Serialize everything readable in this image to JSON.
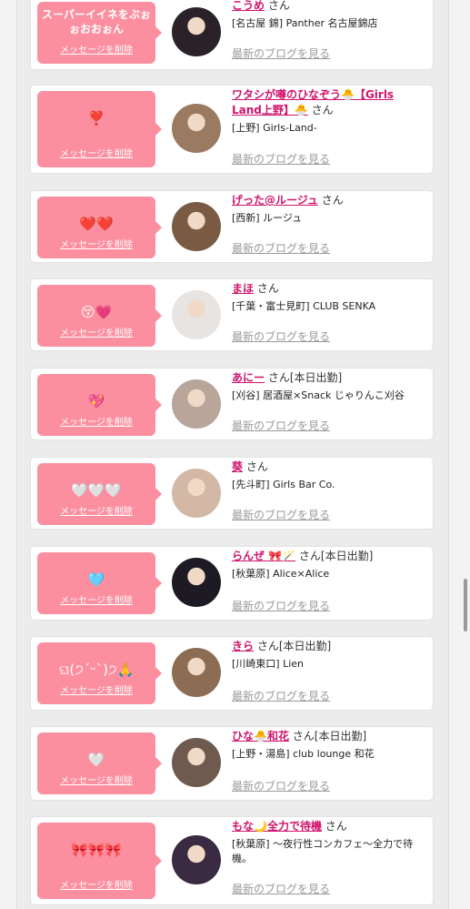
{
  "ui": {
    "san": "さん",
    "delete_label": "メッセージを削除",
    "blog_label": "最新のブログを見る"
  },
  "colors": {
    "bubble": "#fb8fa0",
    "name": "#d0146c",
    "blog_link": "#9a9a9a"
  },
  "cards": [
    {
      "message": "スーパーイイネをぶぉぉおおぉん",
      "name": "こうめ",
      "status": "",
      "shop": "[名古屋 錦] Panther 名古屋錦店",
      "avatar_color": "#2a2228"
    },
    {
      "message": "❣️",
      "name": "ワタシが噂のひなぞう🐣【Girls Land上野】🐣",
      "status": "",
      "shop": "[上野] Girls-Land-",
      "avatar_color": "#9b7a62"
    },
    {
      "message": "❤️❤️",
      "name": "げった@ルージュ",
      "status": "",
      "shop": "[西新] ルージュ",
      "avatar_color": "#7a5a42"
    },
    {
      "message": "😚💗",
      "name": "まほ",
      "status": "",
      "shop": "[千葉・富士見町] CLUB SENKA",
      "avatar_color": "#e8e4e2"
    },
    {
      "message": "💖",
      "name": "あにー",
      "status": "[本日出勤]",
      "shop": "[刈谷] 居酒屋×Snack じゃりんこ刈谷",
      "avatar_color": "#b9a59a"
    },
    {
      "message": "🤍🤍🤍",
      "name": "葵",
      "status": "",
      "shop": "[先斗町] Girls Bar Co.",
      "avatar_color": "#d3b8a6"
    },
    {
      "message": "🩵",
      "name": "らんぜ 🎀🪄",
      "status": "[本日出勤]",
      "shop": "[秋葉原] Alice×Alice",
      "avatar_color": "#1e1a24"
    },
    {
      "message": "ଘ(੭ˊᵕˋ)੭🙏",
      "name": "きら",
      "status": "[本日出勤]",
      "shop": "[川崎東口] Lien",
      "avatar_color": "#8c6c52"
    },
    {
      "message": "🤍",
      "name": "ひな🐣和花",
      "status": "[本日出勤]",
      "shop": "[上野・湯島] club lounge 和花",
      "avatar_color": "#6e5a4e"
    },
    {
      "message": "🎀🎀🎀",
      "name": "もな🌙全力で待機",
      "status": "",
      "shop": "[秋葉原] 〜夜行性コンカフェ〜全力で待機。",
      "avatar_color": "#3a2a42"
    }
  ]
}
